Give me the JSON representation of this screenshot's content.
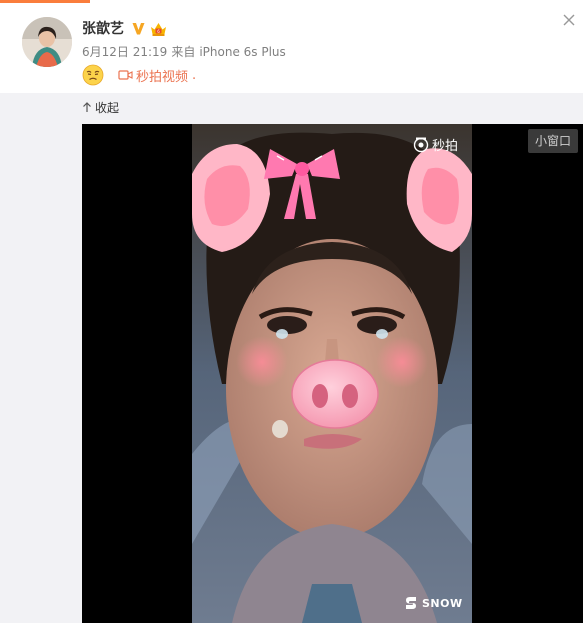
{
  "accent_color": "#fa7d3c",
  "link_color": "#eb7350",
  "header": {
    "username": "张歆艺",
    "verified_icon": "verified-v-badge-icon",
    "member_icon": "weibo-vip-crown-icon"
  },
  "meta": {
    "date": "6月12日 21:19",
    "source_prefix": "来自",
    "source_device": "iPhone 6s Plus"
  },
  "post": {
    "emoji": "crying-face-emoji-icon",
    "video_icon": "video-camera-icon",
    "video_link": "秒拍视频",
    "trailing": "."
  },
  "media": {
    "collapse_label": "收起",
    "mini_window_label": "小窗口",
    "watermark_top": "秒拍",
    "watermark_bottom": "SNOW"
  }
}
